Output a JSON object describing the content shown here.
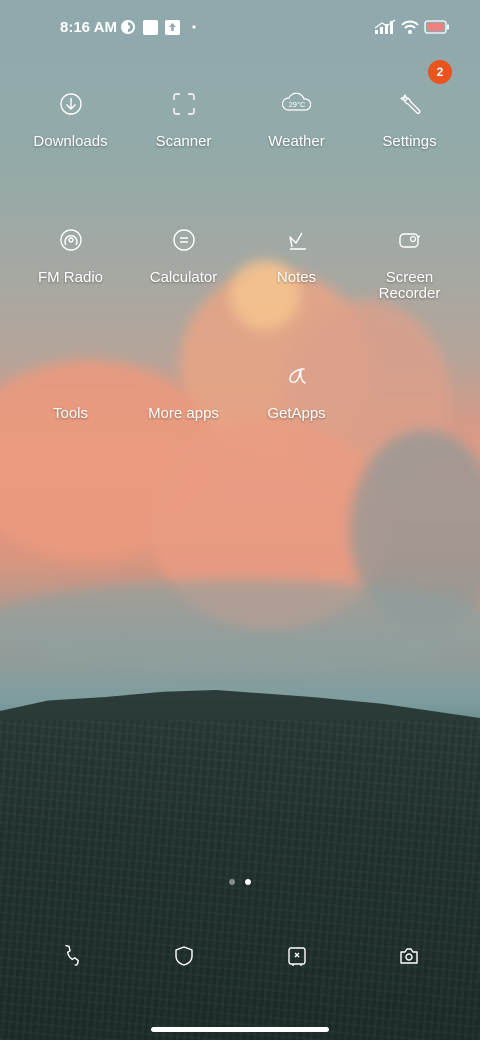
{
  "status_bar": {
    "time": "8:16 AM",
    "icons": [
      "vpn-icon",
      "notification-square-icon",
      "upload-icon",
      "dot-icon",
      "signal-icon",
      "wifi-icon",
      "battery-icon"
    ],
    "battery_level": 1.0,
    "battery_color": "#f08080"
  },
  "badge": {
    "count": "2",
    "color": "#e9531c"
  },
  "apps": [
    {
      "label": "Downloads",
      "icon": "download-icon"
    },
    {
      "label": "Scanner",
      "icon": "scan-icon"
    },
    {
      "label": "Weather",
      "icon": "weather-icon",
      "icon_text": "29°C"
    },
    {
      "label": "Settings",
      "icon": "wrench-icon"
    },
    {
      "label": "FM Radio",
      "icon": "radio-icon"
    },
    {
      "label": "Calculator",
      "icon": "calculator-icon"
    },
    {
      "label": "Notes",
      "icon": "notes-icon"
    },
    {
      "label": "Screen Recorder",
      "icon": "screen-recorder-icon"
    },
    {
      "label": "Tools",
      "icon": "tools-icon"
    },
    {
      "label": "More apps",
      "icon": "more-apps-icon"
    },
    {
      "label": "GetApps",
      "icon": "getapps-icon"
    }
  ],
  "page_indicator": {
    "count": 2,
    "active": 2
  },
  "dock": [
    "phone-icon",
    "security-icon",
    "cleaner-icon",
    "camera-icon"
  ]
}
